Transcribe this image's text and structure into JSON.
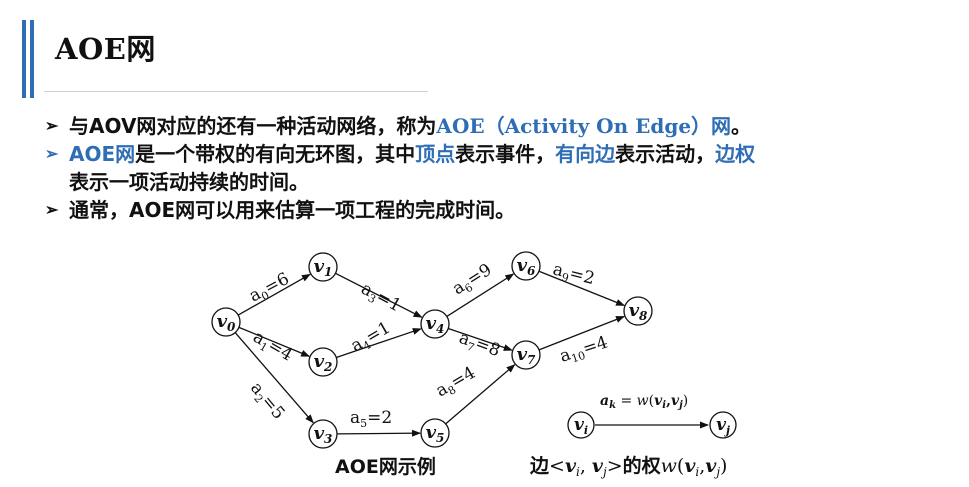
{
  "title": "AOE网",
  "bullets": [
    {
      "marker": "➢",
      "segments": [
        {
          "text": "与AOV网对应的还有一种活动网络，称为",
          "color": "#111111"
        },
        {
          "text": "AOE（Activity On Edge）网",
          "color": "#2f6eb5"
        },
        {
          "text": "。",
          "color": "#111111"
        }
      ]
    },
    {
      "marker": "➢",
      "segments": [
        {
          "text": "AOE网",
          "color": "#2f6eb5"
        },
        {
          "text": "是一个带权的有向无环图，其中",
          "color": "#111111"
        },
        {
          "text": "顶点",
          "color": "#2f6eb5"
        },
        {
          "text": "表示事件，",
          "color": "#111111"
        },
        {
          "text": "有向边",
          "color": "#2f6eb5"
        },
        {
          "text": "表示活动，",
          "color": "#111111"
        },
        {
          "text": "边权",
          "color": "#2f6eb5"
        },
        {
          "text": "表示一项活动持续的时间。",
          "color": "#111111"
        }
      ]
    },
    {
      "marker": "➢",
      "segments": [
        {
          "text": "通常，AOE网可以用来估算一项工程的完成时间。",
          "color": "#111111"
        }
      ]
    }
  ],
  "graph": {
    "nodes": [
      {
        "id": "v0",
        "base": "v",
        "sub": "0"
      },
      {
        "id": "v1",
        "base": "v",
        "sub": "1"
      },
      {
        "id": "v2",
        "base": "v",
        "sub": "2"
      },
      {
        "id": "v3",
        "base": "v",
        "sub": "3"
      },
      {
        "id": "v4",
        "base": "v",
        "sub": "4"
      },
      {
        "id": "v5",
        "base": "v",
        "sub": "5"
      },
      {
        "id": "v6",
        "base": "v",
        "sub": "6"
      },
      {
        "id": "v7",
        "base": "v",
        "sub": "7"
      },
      {
        "id": "v8",
        "base": "v",
        "sub": "8"
      }
    ],
    "edges": [
      {
        "from": "v0",
        "to": "v1",
        "name": "a",
        "sub": "0",
        "weight": "=6"
      },
      {
        "from": "v0",
        "to": "v2",
        "name": "a",
        "sub": "1",
        "weight": "=4"
      },
      {
        "from": "v0",
        "to": "v3",
        "name": "a",
        "sub": "2",
        "weight": "=5"
      },
      {
        "from": "v1",
        "to": "v4",
        "name": "a",
        "sub": "3",
        "weight": "=1"
      },
      {
        "from": "v2",
        "to": "v4",
        "name": "a",
        "sub": "4",
        "weight": "=1"
      },
      {
        "from": "v3",
        "to": "v5",
        "name": "a",
        "sub": "5",
        "weight": "=2"
      },
      {
        "from": "v4",
        "to": "v6",
        "name": "a",
        "sub": "6",
        "weight": "=9"
      },
      {
        "from": "v4",
        "to": "v7",
        "name": "a",
        "sub": "7",
        "weight": "=8"
      },
      {
        "from": "v5",
        "to": "v7",
        "name": "a",
        "sub": "8",
        "weight": "=4"
      },
      {
        "from": "v6",
        "to": "v8",
        "name": "a",
        "sub": "9",
        "weight": "=2"
      },
      {
        "from": "v7",
        "to": "v8",
        "name": "a",
        "sub": "10",
        "weight": "=4"
      }
    ],
    "caption": "AOE网示例"
  },
  "legend": {
    "formula": {
      "a": "a",
      "k": "k",
      "eq": " = ",
      "w": "w",
      "open": "(",
      "vi": "v",
      "i": "i",
      "comma": ",",
      "vj": "v",
      "j": "j",
      "close": ")"
    },
    "node_i": {
      "base": "v",
      "sub": "i"
    },
    "node_j": {
      "base": "v",
      "sub": "j"
    },
    "caption": {
      "prefix": "边",
      "lt": "<",
      "v1": "v",
      "s1": "i",
      "comma": ", ",
      "v2": "v",
      "s2": "j",
      "gt": ">",
      "middle": "的权",
      "w": "w",
      "open": "(",
      "v3": "v",
      "s3": "i",
      "comma2": ",",
      "v4": "v",
      "s4": "j",
      "close": ")"
    }
  }
}
